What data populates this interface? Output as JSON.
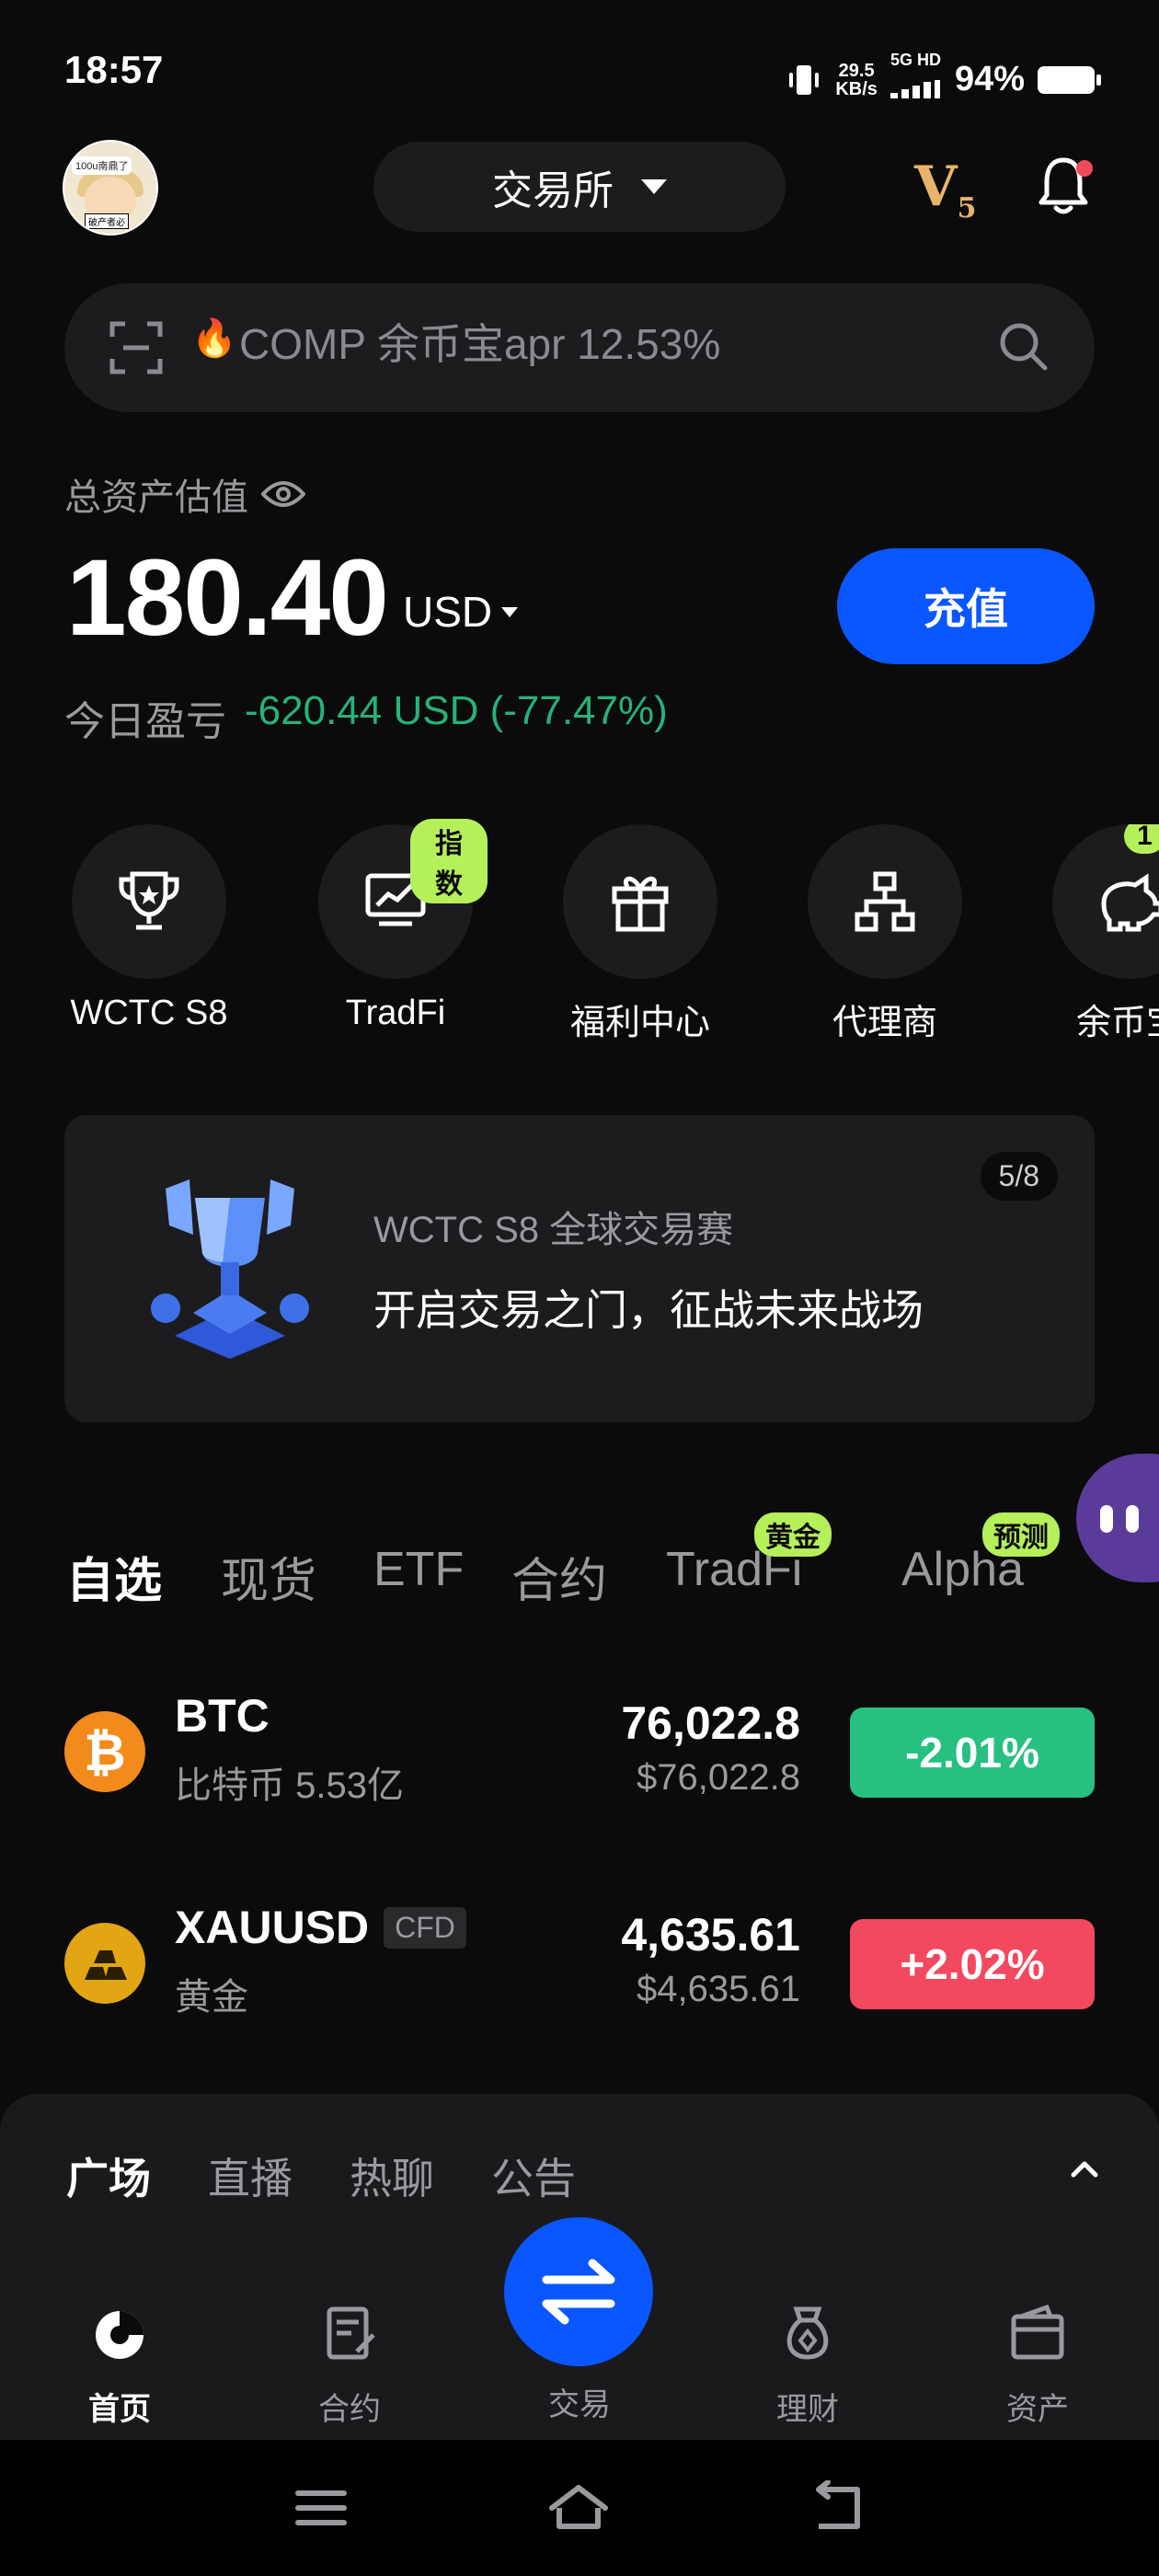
{
  "status_bar": {
    "time": "18:57",
    "net_speed_value": "29.5",
    "net_speed_unit": "KB/s",
    "signal_label": "5G HD",
    "battery": "94%"
  },
  "header": {
    "avatar_tag": "100u南鼎了",
    "avatar_sign": "破产者必",
    "exchange_label": "交易所",
    "vip_letter": "V",
    "vip_level": "5"
  },
  "search": {
    "placeholder": "COMP 余币宝apr 12.53%"
  },
  "assets": {
    "label": "总资产估值",
    "value": "180.40",
    "currency": "USD",
    "deposit_label": "充值",
    "pnl_label": "今日盈亏",
    "pnl_value": "-620.44 USD (-77.47%)"
  },
  "shortcuts": [
    {
      "label": "WCTC S8",
      "badge": ""
    },
    {
      "label": "TradFi",
      "badge": "指数"
    },
    {
      "label": "福利中心",
      "badge": ""
    },
    {
      "label": "代理商",
      "badge": ""
    },
    {
      "label": "余币宝",
      "badge": "1"
    }
  ],
  "banner": {
    "page": "5/8",
    "subtitle": "WCTC S8 全球交易赛",
    "title": "开启交易之门，征战未来战场"
  },
  "market_tabs": [
    {
      "label": "自选",
      "badge": ""
    },
    {
      "label": "现货",
      "badge": ""
    },
    {
      "label": "ETF",
      "badge": ""
    },
    {
      "label": "合约",
      "badge": ""
    },
    {
      "label": "TradFi",
      "badge": "黄金"
    },
    {
      "label": "Alpha",
      "badge": "预测"
    }
  ],
  "market_rows": [
    {
      "symbol": "BTC",
      "tag": "",
      "name": "比特币 5.53亿",
      "price": "76,022.8",
      "price_usd": "$76,022.8",
      "change": "-2.01%",
      "change_color": "#27c081"
    },
    {
      "symbol": "XAUUSD",
      "tag": "CFD",
      "name": "黄金",
      "price": "4,635.61",
      "price_usd": "$4,635.61",
      "change": "+2.02%",
      "change_color": "#f2495f"
    }
  ],
  "sheet_tabs": [
    "广场",
    "直播",
    "热聊",
    "公告"
  ],
  "bottom_nav": [
    {
      "label": "首页",
      "icon": "home-icon"
    },
    {
      "label": "合约",
      "icon": "contract-icon"
    },
    {
      "label": "交易",
      "icon": "swap-icon"
    },
    {
      "label": "理财",
      "icon": "finance-icon"
    },
    {
      "label": "资产",
      "icon": "wallet-icon"
    }
  ],
  "colors": {
    "accent": "#0a56ff",
    "positive": "#25b37a",
    "negative": "#f2495f",
    "badge": "#b5f05a",
    "vip": "#e9b46a"
  }
}
